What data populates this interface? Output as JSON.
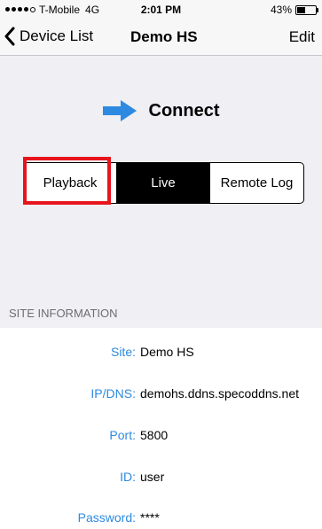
{
  "status_bar": {
    "carrier": "T-Mobile",
    "network": "4G",
    "time": "2:01 PM",
    "battery": "43%",
    "battery_level": 0.43
  },
  "nav": {
    "back_label": "Device List",
    "title": "Demo HS",
    "edit_label": "Edit"
  },
  "connect": {
    "label": "Connect"
  },
  "segments": {
    "playback": "Playback",
    "live": "Live",
    "remote_log": "Remote Log",
    "selected": "Live"
  },
  "site_info": {
    "header": "SITE INFORMATION",
    "rows": [
      {
        "key": "Site:",
        "value": "Demo HS"
      },
      {
        "key": "IP/DNS:",
        "value": "demohs.ddns.specoddns.net"
      },
      {
        "key": "Port:",
        "value": "5800"
      },
      {
        "key": "ID:",
        "value": "user"
      },
      {
        "key": "Password:",
        "value": "****"
      }
    ]
  },
  "colors": {
    "accent": "#2d8ae0",
    "highlight": "#e8141c"
  }
}
